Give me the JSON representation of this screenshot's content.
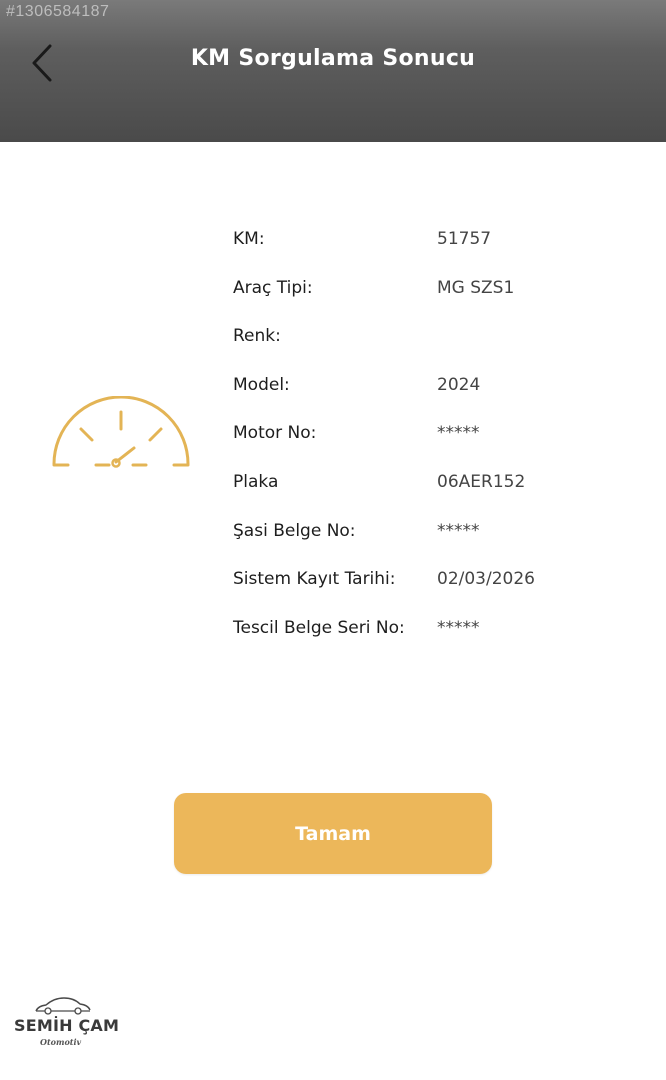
{
  "watermark": "#1306584187",
  "header": {
    "title": "KM Sorgulama Sonucu",
    "back_icon": "chevron-left-icon"
  },
  "colors": {
    "accent": "#ecb75a",
    "header_top": "#7a7a7a",
    "header_bottom": "#4a4a4a"
  },
  "gauge": {
    "icon": "speedometer-icon"
  },
  "result": {
    "rows": [
      {
        "label": "KM:",
        "value": "51757"
      },
      {
        "label": "Araç Tipi:",
        "value": "MG SZS1"
      },
      {
        "label": "Renk:",
        "value": ""
      },
      {
        "label": "Model:",
        "value": "2024"
      },
      {
        "label": "Motor No:",
        "value": "*****"
      },
      {
        "label": "Plaka",
        "value": "06AER152"
      },
      {
        "label": "Şasi Belge No:",
        "value": "*****"
      },
      {
        "label": "Sistem Kayıt Tarihi:",
        "value": "02/03/2026"
      },
      {
        "label": "Tescil Belge Seri No:",
        "value": "*****"
      }
    ]
  },
  "ok_button": {
    "label": "Tamam"
  },
  "brand": {
    "name": "SEMİH ÇAM",
    "sub": "Otomotiv",
    "icon": "car-icon"
  }
}
